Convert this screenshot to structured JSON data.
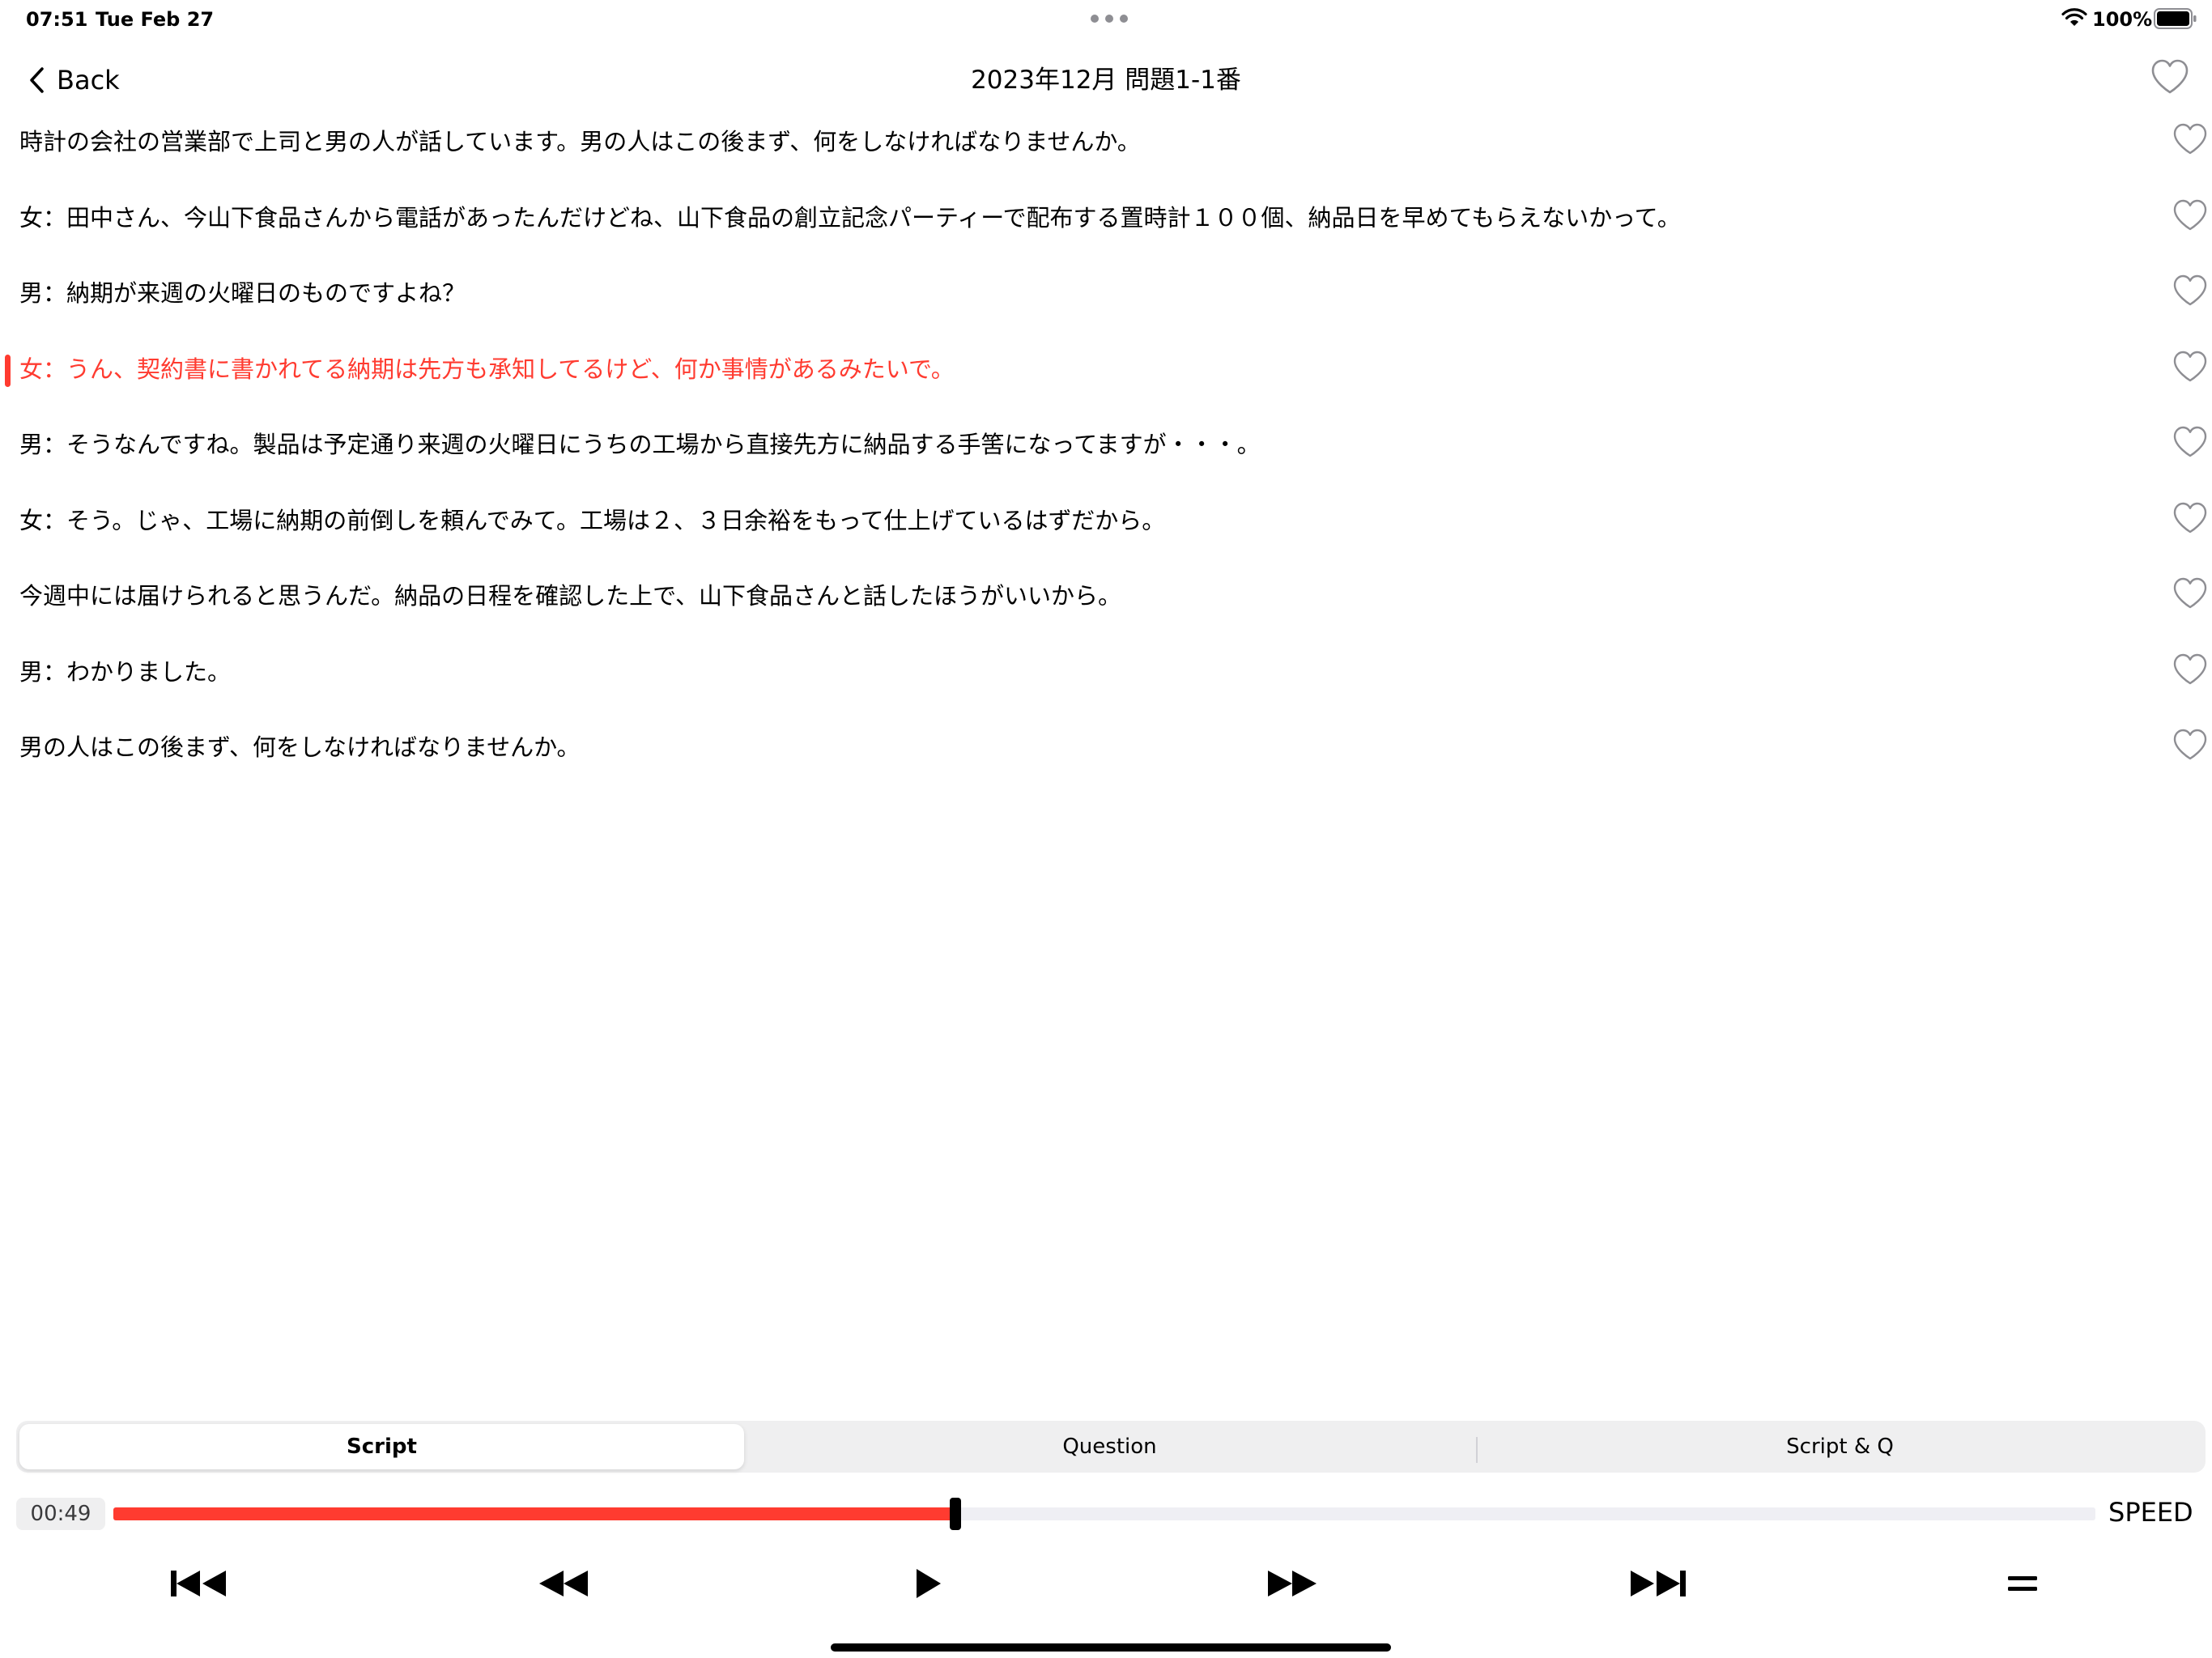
{
  "status_bar": {
    "time": "07:51",
    "date": "Tue Feb 27",
    "battery": "100%"
  },
  "nav": {
    "back_label": "Back",
    "title": "2023年12月 問題1-1番"
  },
  "script": {
    "lines": [
      {
        "text": "時計の会社の営業部で上司と男の人が話しています。男の人はこの後まず、何をしなければなりませんか。",
        "active": false
      },
      {
        "text": "女：田中さん、今山下食品さんから電話があったんだけどね、山下食品の創立記念パーティーで配布する置時計１００個、納品日を早めてもらえないかって。",
        "active": false
      },
      {
        "text": "男：納期が来週の火曜日のものですよね？",
        "active": false
      },
      {
        "text": "女：うん、契約書に書かれてる納期は先方も承知してるけど、何か事情があるみたいで。",
        "active": true
      },
      {
        "text": "男：そうなんですね。製品は予定通り来週の火曜日にうちの工場から直接先方に納品する手筈になってますが・・・。",
        "active": false
      },
      {
        "text": "女：そう。じゃ、工場に納期の前倒しを頼んでみて。工場は２、３日余裕をもって仕上げているはずだから。",
        "active": false
      },
      {
        "text": "今週中には届けられると思うんだ。納品の日程を確認した上で、山下食品さんと話したほうがいいから。",
        "active": false
      },
      {
        "text": "男：わかりました。",
        "active": false
      },
      {
        "text": "男の人はこの後まず、何をしなければなりませんか。",
        "active": false
      }
    ]
  },
  "tabs": [
    {
      "label": "Script",
      "selected": true
    },
    {
      "label": "Question",
      "selected": false
    },
    {
      "label": "Script & Q",
      "selected": false
    }
  ],
  "player": {
    "elapsed": "00:49",
    "progress": 0.425,
    "speed_label": "SPEED",
    "accent_color": "#ff3b30"
  },
  "controls": [
    {
      "icon": "skip-to-start-icon"
    },
    {
      "icon": "rewind-icon"
    },
    {
      "icon": "play-icon"
    },
    {
      "icon": "fast-forward-icon"
    },
    {
      "icon": "skip-to-end-icon"
    },
    {
      "icon": "reorder-icon"
    }
  ]
}
